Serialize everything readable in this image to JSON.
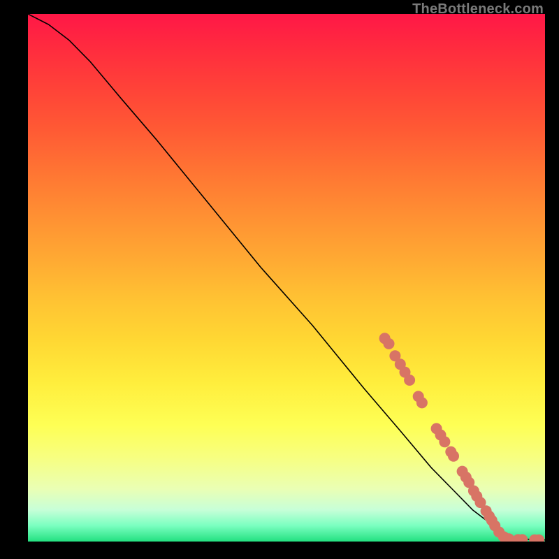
{
  "watermark": "TheBottleneck.com",
  "chart_data": {
    "type": "line",
    "title": "",
    "xlabel": "",
    "ylabel": "",
    "xlim": [
      0,
      100
    ],
    "ylim": [
      0,
      100
    ],
    "series": [
      {
        "name": "curve",
        "x": [
          0,
          4,
          8,
          12,
          18,
          25,
          35,
          45,
          55,
          65,
          72,
          78,
          82,
          86,
          90,
          93,
          96,
          98,
          100
        ],
        "y": [
          100,
          98,
          95,
          91,
          84,
          76,
          64,
          52,
          41,
          29,
          21,
          14,
          10,
          6,
          3,
          1,
          0.5,
          0.3,
          0.3
        ]
      }
    ],
    "dots": {
      "name": "markers",
      "points": [
        {
          "x": 69.0,
          "y": 38.5
        },
        {
          "x": 69.8,
          "y": 37.5
        },
        {
          "x": 71.0,
          "y": 35.2
        },
        {
          "x": 72.0,
          "y": 33.6
        },
        {
          "x": 72.9,
          "y": 32.1
        },
        {
          "x": 73.8,
          "y": 30.6
        },
        {
          "x": 75.5,
          "y": 27.5
        },
        {
          "x": 76.2,
          "y": 26.3
        },
        {
          "x": 79.0,
          "y": 21.4
        },
        {
          "x": 79.8,
          "y": 20.2
        },
        {
          "x": 80.6,
          "y": 18.9
        },
        {
          "x": 81.8,
          "y": 17.0
        },
        {
          "x": 82.3,
          "y": 16.2
        },
        {
          "x": 84.0,
          "y": 13.3
        },
        {
          "x": 84.7,
          "y": 12.2
        },
        {
          "x": 85.3,
          "y": 11.2
        },
        {
          "x": 86.2,
          "y": 9.6
        },
        {
          "x": 86.8,
          "y": 8.6
        },
        {
          "x": 87.5,
          "y": 7.4
        },
        {
          "x": 88.6,
          "y": 5.8
        },
        {
          "x": 89.2,
          "y": 4.8
        },
        {
          "x": 89.7,
          "y": 4.0
        },
        {
          "x": 90.3,
          "y": 3.0
        },
        {
          "x": 91.1,
          "y": 1.8
        },
        {
          "x": 92.0,
          "y": 0.9
        },
        {
          "x": 93.0,
          "y": 0.5
        },
        {
          "x": 94.8,
          "y": 0.35
        },
        {
          "x": 95.6,
          "y": 0.35
        },
        {
          "x": 98.0,
          "y": 0.3
        },
        {
          "x": 98.8,
          "y": 0.3
        }
      ],
      "color": "#d87465",
      "radius_px": 8
    },
    "gradient_stops": [
      {
        "pos": 0.0,
        "color": "#ff1747"
      },
      {
        "pos": 0.5,
        "color": "#ffbb33"
      },
      {
        "pos": 0.8,
        "color": "#feff55"
      },
      {
        "pos": 1.0,
        "color": "#23e080"
      }
    ]
  }
}
